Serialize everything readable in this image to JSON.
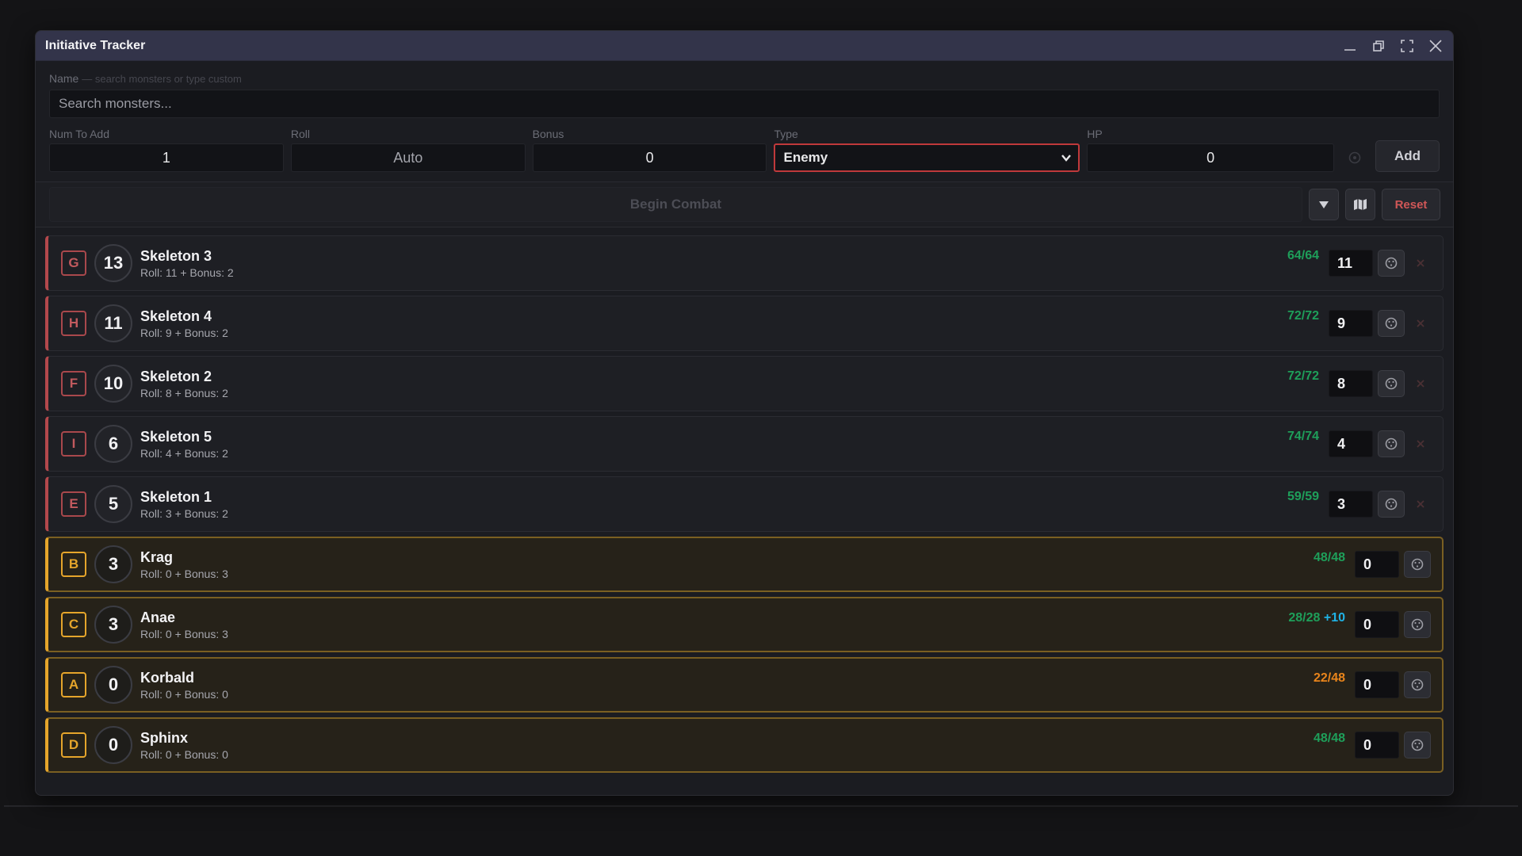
{
  "window": {
    "title": "Initiative Tracker"
  },
  "form": {
    "name_label": "Name",
    "name_hint": "— search monsters or type custom",
    "search_placeholder": "Search monsters...",
    "num_label": "Num To Add",
    "num_value": "1",
    "roll_label": "Roll",
    "roll_value": "Auto",
    "bonus_label": "Bonus",
    "bonus_value": "0",
    "type_label": "Type",
    "type_value": "Enemy",
    "hp_label": "HP",
    "hp_value": "0",
    "add_label": "Add"
  },
  "combat": {
    "begin_label": "Begin Combat",
    "reset_label": "Reset"
  },
  "colors": {
    "enemy_accent": "#b3484c",
    "ally_accent": "#e5a52b",
    "hp_full": "#1e9f5a",
    "hp_damaged": "#e8841b",
    "temp_hp": "#1fb3e6"
  },
  "combatants": [
    {
      "letter": "G",
      "init": "13",
      "name": "Skeleton 3",
      "detail": "Roll: 11 + Bonus: 2",
      "hp": "64/64",
      "temp": "",
      "value": "11",
      "side": "enemy"
    },
    {
      "letter": "H",
      "init": "11",
      "name": "Skeleton 4",
      "detail": "Roll: 9 + Bonus: 2",
      "hp": "72/72",
      "temp": "",
      "value": "9",
      "side": "enemy"
    },
    {
      "letter": "F",
      "init": "10",
      "name": "Skeleton 2",
      "detail": "Roll: 8 + Bonus: 2",
      "hp": "72/72",
      "temp": "",
      "value": "8",
      "side": "enemy"
    },
    {
      "letter": "I",
      "init": "6",
      "name": "Skeleton 5",
      "detail": "Roll: 4 + Bonus: 2",
      "hp": "74/74",
      "temp": "",
      "value": "4",
      "side": "enemy"
    },
    {
      "letter": "E",
      "init": "5",
      "name": "Skeleton 1",
      "detail": "Roll: 3 + Bonus: 2",
      "hp": "59/59",
      "temp": "",
      "value": "3",
      "side": "enemy"
    },
    {
      "letter": "B",
      "init": "3",
      "name": "Krag",
      "detail": "Roll: 0 + Bonus: 3",
      "hp": "48/48",
      "temp": "",
      "value": "0",
      "side": "ally"
    },
    {
      "letter": "C",
      "init": "3",
      "name": "Anae",
      "detail": "Roll: 0 + Bonus: 3",
      "hp": "28/28",
      "temp": "+10",
      "value": "0",
      "side": "ally"
    },
    {
      "letter": "A",
      "init": "0",
      "name": "Korbald",
      "detail": "Roll: 0 + Bonus: 0",
      "hp": "22/48",
      "temp": "",
      "value": "0",
      "side": "ally",
      "damaged": true
    },
    {
      "letter": "D",
      "init": "0",
      "name": "Sphinx",
      "detail": "Roll: 0 + Bonus: 0",
      "hp": "48/48",
      "temp": "",
      "value": "0",
      "side": "ally"
    }
  ]
}
